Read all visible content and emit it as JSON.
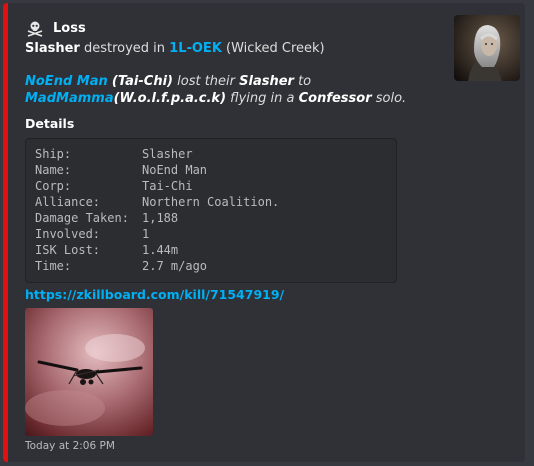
{
  "embed": {
    "accent_color": "#e01010",
    "author": {
      "name": "Loss",
      "icon": "skull-crossbones-icon"
    },
    "title": {
      "ship": "Slasher",
      "text_destroyed": "destroyed in",
      "system": "1L-OEK",
      "region": "(Wicked Creek)"
    },
    "description": {
      "victim": "NoEnd Man",
      "victim_corp": "(Tai-Chi)",
      "text_lost": "lost their",
      "ship": "Slasher",
      "text_to": "to",
      "attacker": "MadMamma",
      "attacker_corp": "(W.o.l.f.p.a.c.k)",
      "text_flying": "flying in a",
      "attacker_ship": "Confessor",
      "text_solo": "solo."
    },
    "field": {
      "name": "Details",
      "rows": [
        {
          "key": "Ship:",
          "value": "Slasher"
        },
        {
          "key": "Name:",
          "value": "NoEnd Man"
        },
        {
          "key": "Corp:",
          "value": "Tai-Chi"
        },
        {
          "key": "Alliance:",
          "value": "Northern Coalition."
        },
        {
          "key": "Damage Taken:",
          "value": "1,188"
        },
        {
          "key": "Involved:",
          "value": "1"
        },
        {
          "key": "ISK Lost:",
          "value": "1.44m"
        },
        {
          "key": "Time:",
          "value": "2.7 m/ago"
        }
      ]
    },
    "link": "https://zkillboard.com/kill/71547919/",
    "footer": "Today at 2:06 PM"
  }
}
